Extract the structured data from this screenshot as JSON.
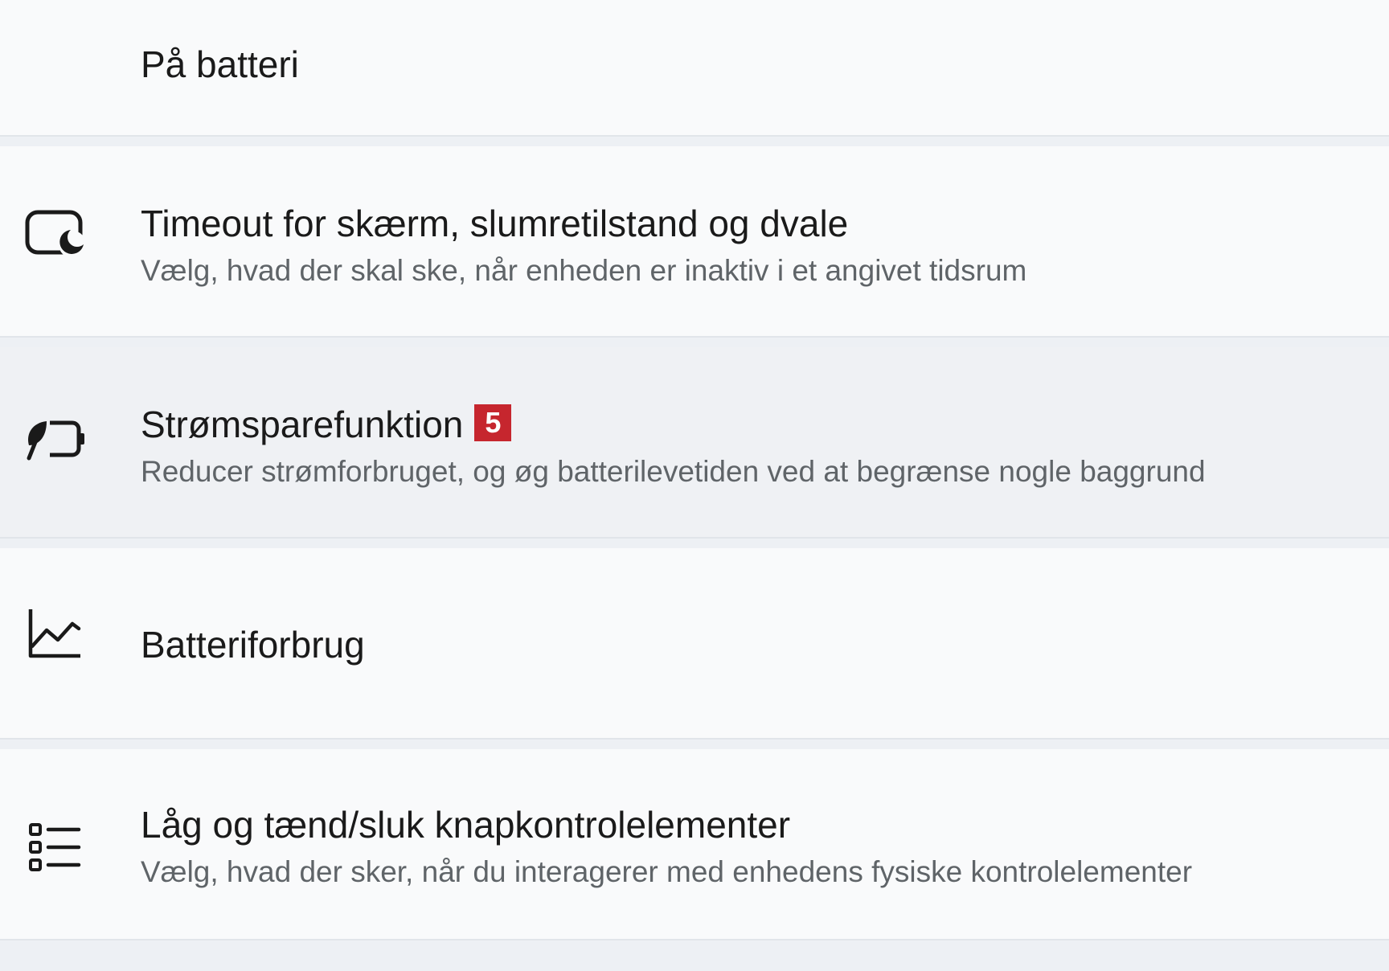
{
  "section_header": {
    "label": "På batteri"
  },
  "items": [
    {
      "icon": "screen-sleep-icon",
      "title": "Timeout for skærm, slumretilstand og dvale",
      "description": "Vælg, hvad der skal ske, når enheden er inaktiv i et angivet tidsrum"
    },
    {
      "icon": "energy-saver-icon",
      "title": "Strømsparefunktion",
      "badge": "5",
      "badge_color": "#c6262e",
      "description": "Reducer strømforbruget, og øg batterilevetiden ved at begrænse nogle baggrund"
    },
    {
      "icon": "battery-usage-chart-icon",
      "title": "Batteriforbrug"
    },
    {
      "icon": "checklist-icon",
      "title": "Låg og tænd/sluk knapkontrolelementer",
      "description": "Vælg, hvad der sker, når du interagerer med enhedens fysiske kontrolelementer"
    }
  ]
}
